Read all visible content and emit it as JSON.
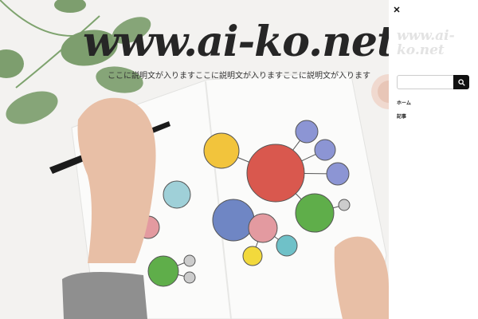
{
  "site": {
    "title": "www.ai-ko.net",
    "description": "ここに説明文が入りますここに説明文が入りますここに説明文が入ります"
  },
  "panel": {
    "title": "www.ai-ko.net",
    "search_placeholder": "",
    "menu": [
      {
        "label": "ホーム"
      },
      {
        "label": "記事"
      }
    ]
  },
  "icons": {
    "close": "close-icon",
    "search": "search-icon"
  },
  "colors": {
    "circle_red": "#d9584e",
    "circle_blue": "#6f86c4",
    "circle_green": "#5fae4a",
    "circle_yellow": "#f2c43c",
    "circle_teal": "#6fc1c8",
    "circle_pink": "#e39aa0"
  }
}
